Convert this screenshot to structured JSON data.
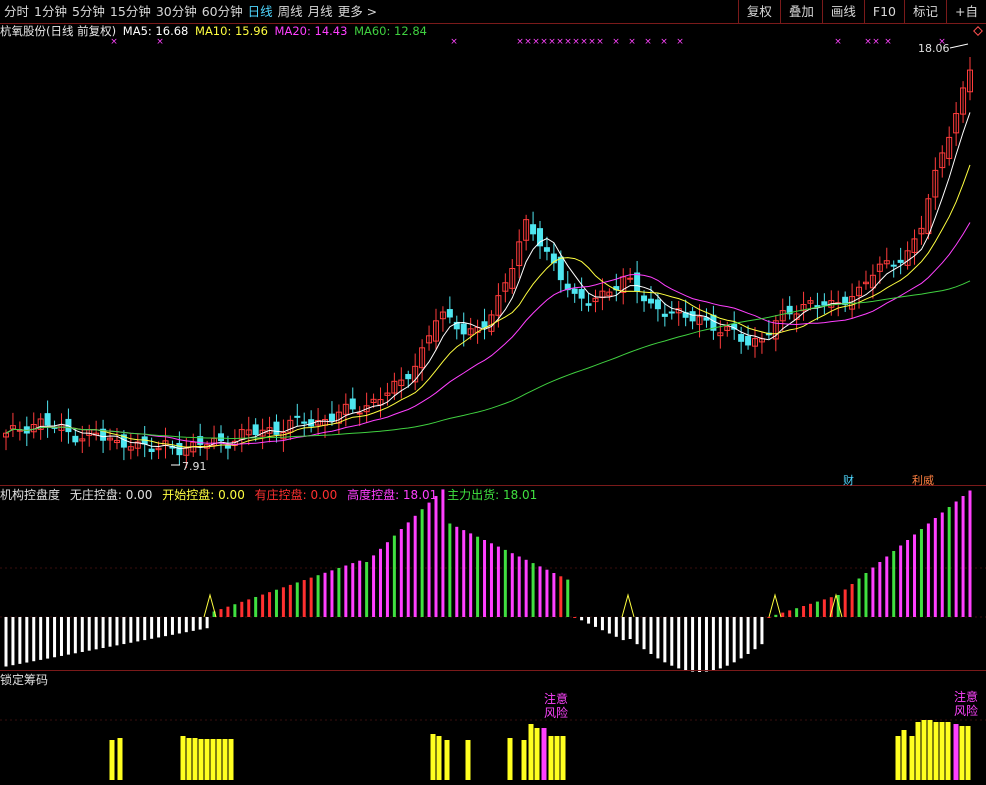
{
  "toolbar": {
    "periods": [
      {
        "label": "分时",
        "active": false
      },
      {
        "label": "1分钟",
        "active": false
      },
      {
        "label": "5分钟",
        "active": false
      },
      {
        "label": "15分钟",
        "active": false
      },
      {
        "label": "30分钟",
        "active": false
      },
      {
        "label": "60分钟",
        "active": false
      },
      {
        "label": "日线",
        "active": true
      },
      {
        "label": "周线",
        "active": false
      },
      {
        "label": "月线",
        "active": false
      },
      {
        "label": "更多 >",
        "active": false
      }
    ],
    "right_buttons": [
      "复权",
      "叠加",
      "画线",
      "F10",
      "标记",
      "+自"
    ]
  },
  "legend": {
    "stock": "杭氧股份(日线 前复权)",
    "ma5": "MA5: 16.68",
    "ma10": "MA10: 15.96",
    "ma20": "MA20: 14.43",
    "ma60": "MA60: 12.84"
  },
  "colors": {
    "up": "#ff3c3c",
    "down": "#4fe6f0",
    "ma5": "#ffffff",
    "ma10": "#ffff40",
    "ma20": "#ff40ff",
    "ma60": "#40d040",
    "accent": "#7a1a1a"
  },
  "price_panel": {
    "high_label": "18.06",
    "low_label": "7.91",
    "badge_fin": "财",
    "badge_ben": "利威"
  },
  "indicator1": {
    "title": "机构控盘度",
    "items": [
      {
        "label": "无庄控盘: 0.00",
        "color": "#e0e0e0"
      },
      {
        "label": "开始控盘: 0.00",
        "color": "#ffff40"
      },
      {
        "label": "有庄控盘: 0.00",
        "color": "#ff3030"
      },
      {
        "label": "高度控盘: 18.01",
        "color": "#ff40ff"
      },
      {
        "label": "主力出货: 18.01",
        "color": "#40e040"
      }
    ]
  },
  "indicator2": {
    "title": "锁定筹码",
    "warn1": "注意风险",
    "warn2": "注意风险"
  },
  "chart_data": {
    "type": "candlestick",
    "series_close": [
      8.3,
      8.5,
      8.6,
      8.7,
      8.5,
      8.4,
      8.3,
      8.4,
      8.2,
      8.1,
      8.2,
      8.0,
      7.9,
      8.1,
      8.0,
      7.95,
      8.1,
      8.2,
      8.15,
      8.3,
      8.4,
      8.5,
      8.45,
      8.6,
      8.7,
      8.65,
      8.8,
      8.9,
      9.0,
      9.1,
      9.3,
      9.5,
      9.7,
      10.2,
      10.8,
      11.6,
      11.3,
      11.2,
      11.1,
      11.3,
      12.0,
      13.0,
      14.0,
      13.5,
      13.0,
      12.6,
      12.0,
      11.8,
      12.0,
      12.3,
      12.5,
      12.2,
      11.8,
      11.7,
      11.6,
      11.4,
      11.5,
      11.3,
      11.1,
      11.0,
      10.8,
      10.9,
      11.2,
      11.5,
      11.7,
      11.9,
      11.8,
      11.7,
      12.0,
      12.2,
      12.6,
      12.8,
      13.0,
      13.2,
      13.8,
      15.0,
      16.2,
      17.0,
      18.06
    ]
  }
}
